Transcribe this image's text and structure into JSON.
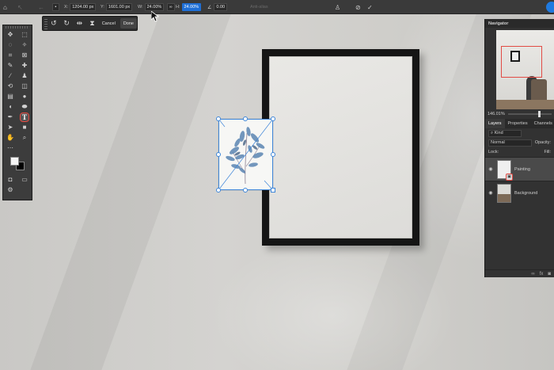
{
  "options_bar": {
    "x_label": "X:",
    "x_value": "1204.00 px",
    "y_label": "Y:",
    "y_value": "1601.00 px",
    "w_label": "W:",
    "w_value": "24.00%",
    "h_label": "H:",
    "h_value": "24.00%",
    "angle_value": "0.00",
    "anti_alias_label": "Anti-alias"
  },
  "transform_bar": {
    "cancel_label": "Cancel",
    "done_label": "Done"
  },
  "panels": {
    "navigator_title": "Navigator",
    "zoom_level": "146.01%",
    "tabs": [
      "Layers",
      "Properties",
      "Channels"
    ],
    "kind_placeholder": "Kind",
    "blend_mode": "Normal",
    "opacity_label": "Opacity:",
    "lock_label": "Lock:",
    "fill_label": "Fill:",
    "layers": [
      {
        "name": "Painting",
        "selected": true
      },
      {
        "name": "Background",
        "selected": false
      }
    ],
    "footer_icons": [
      "link-icon",
      "fx-icon",
      "mask-icon"
    ]
  },
  "colors": {
    "accent": "#1f6fd6",
    "highlight": "#e24b45",
    "selection": "#3e86d9"
  }
}
